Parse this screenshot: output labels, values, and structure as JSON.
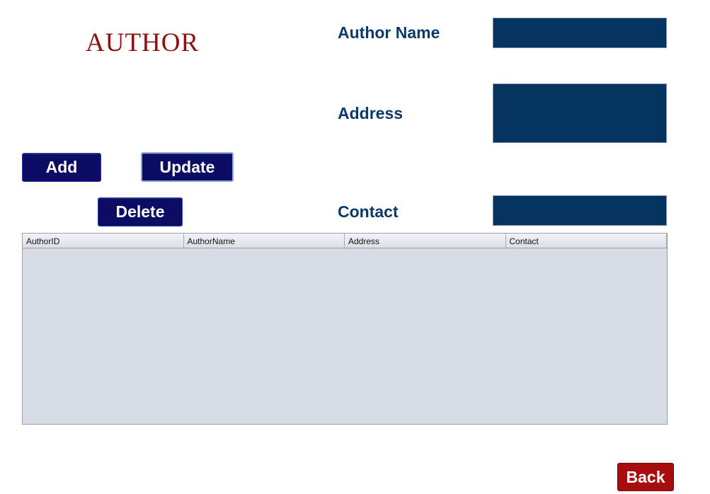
{
  "logo": {
    "title": "AUTHOR"
  },
  "form": {
    "author_name_label": "Author Name",
    "author_name_value": "",
    "address_label": "Address",
    "address_value": "",
    "contact_label": "Contact",
    "contact_value": ""
  },
  "buttons": {
    "add_label": "Add",
    "update_label": "Update",
    "delete_label": "Delete",
    "back_label": "Back"
  },
  "table": {
    "columns": [
      "AuthorID",
      "AuthorName",
      "Address",
      "Contact"
    ],
    "rows": []
  },
  "colors": {
    "title": "#8b1010",
    "label": "#0b3a6a",
    "input_bg": "#04335f",
    "button_bg": "#0a0d63",
    "back_bg": "#a80d0d",
    "table_bg": "#d7dbe3"
  }
}
